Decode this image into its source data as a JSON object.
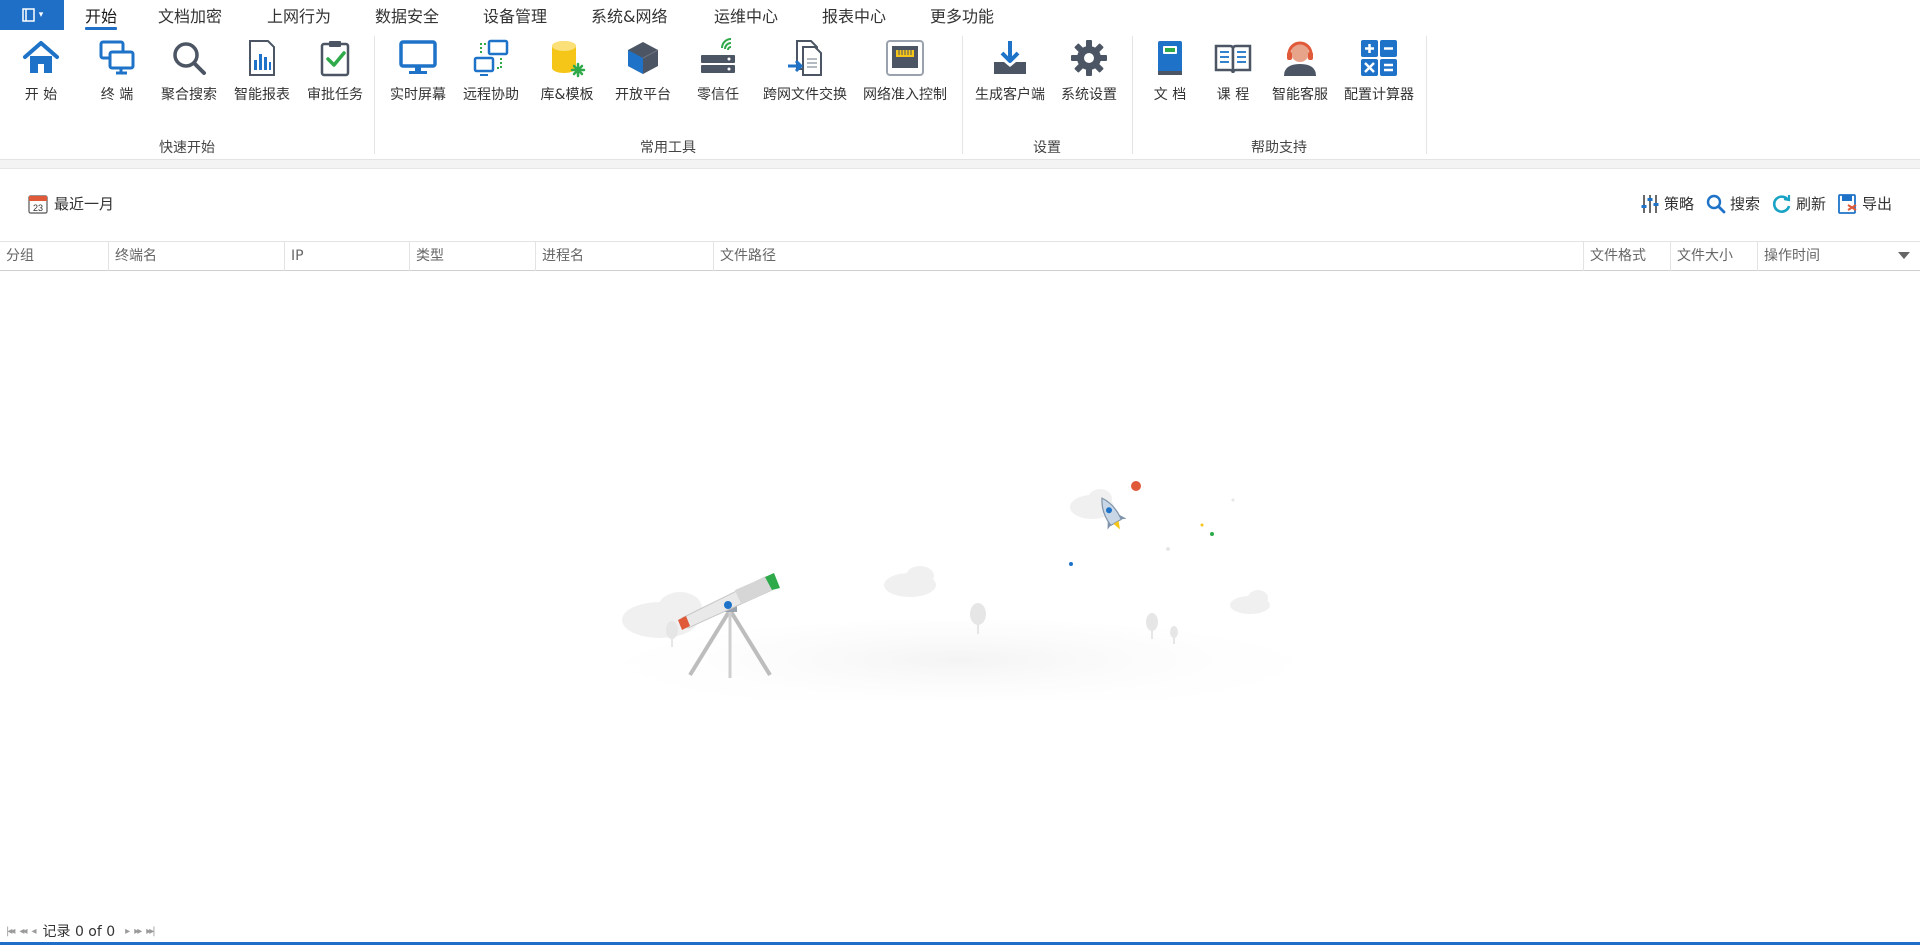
{
  "menu": {
    "tabs": [
      {
        "label": "开始"
      },
      {
        "label": "文档加密"
      },
      {
        "label": "上网行为"
      },
      {
        "label": "数据安全"
      },
      {
        "label": "设备管理"
      },
      {
        "label": "系统&网络"
      },
      {
        "label": "运维中心"
      },
      {
        "label": "报表中心"
      },
      {
        "label": "更多功能"
      }
    ],
    "active_tab": "开始"
  },
  "ribbon": {
    "groups": [
      {
        "label": "快速开始",
        "items": [
          {
            "label": "开 始",
            "icon": "home-icon"
          },
          {
            "label": "终 端",
            "icon": "terminals-icon"
          },
          {
            "label": "聚合搜索",
            "icon": "search-icon"
          },
          {
            "label": "智能报表",
            "icon": "report-icon"
          },
          {
            "label": "审批任务",
            "icon": "approval-icon"
          }
        ]
      },
      {
        "label": "常用工具",
        "items": [
          {
            "label": "实时屏幕",
            "icon": "monitor-icon"
          },
          {
            "label": "远程协助",
            "icon": "remote-assist-icon"
          },
          {
            "label": "库&模板",
            "icon": "database-template-icon"
          },
          {
            "label": "开放平台",
            "icon": "open-platform-icon"
          },
          {
            "label": "零信任",
            "icon": "zero-trust-icon"
          },
          {
            "label": "跨网文件交换",
            "icon": "file-exchange-icon"
          },
          {
            "label": "网络准入控制",
            "icon": "network-access-icon"
          }
        ]
      },
      {
        "label": "设置",
        "items": [
          {
            "label": "生成客户端",
            "icon": "download-client-icon"
          },
          {
            "label": "系统设置",
            "icon": "gear-icon"
          }
        ]
      },
      {
        "label": "帮助支持",
        "items": [
          {
            "label": "文 档",
            "icon": "book-icon"
          },
          {
            "label": "课 程",
            "icon": "open-book-icon"
          },
          {
            "label": "智能客服",
            "icon": "headset-icon"
          },
          {
            "label": "配置计算器",
            "icon": "calculator-icon"
          }
        ]
      }
    ]
  },
  "toolbar": {
    "date_range": "最近一月",
    "calendar_day": "23",
    "policy": "策略",
    "search": "搜索",
    "refresh": "刷新",
    "export": "导出"
  },
  "table": {
    "columns": [
      "分组",
      "终端名",
      "IP",
      "类型",
      "进程名",
      "文件路径",
      "文件格式",
      "文件大小",
      "操作时间"
    ],
    "rows": []
  },
  "status": {
    "records": "记录 0 of 0"
  },
  "colors": {
    "accent": "#1f6fc6",
    "icon_blue": "#1e73c8",
    "icon_gray": "#4b5563",
    "icon_yellow": "#f5c518",
    "icon_green": "#2eaa4a"
  }
}
